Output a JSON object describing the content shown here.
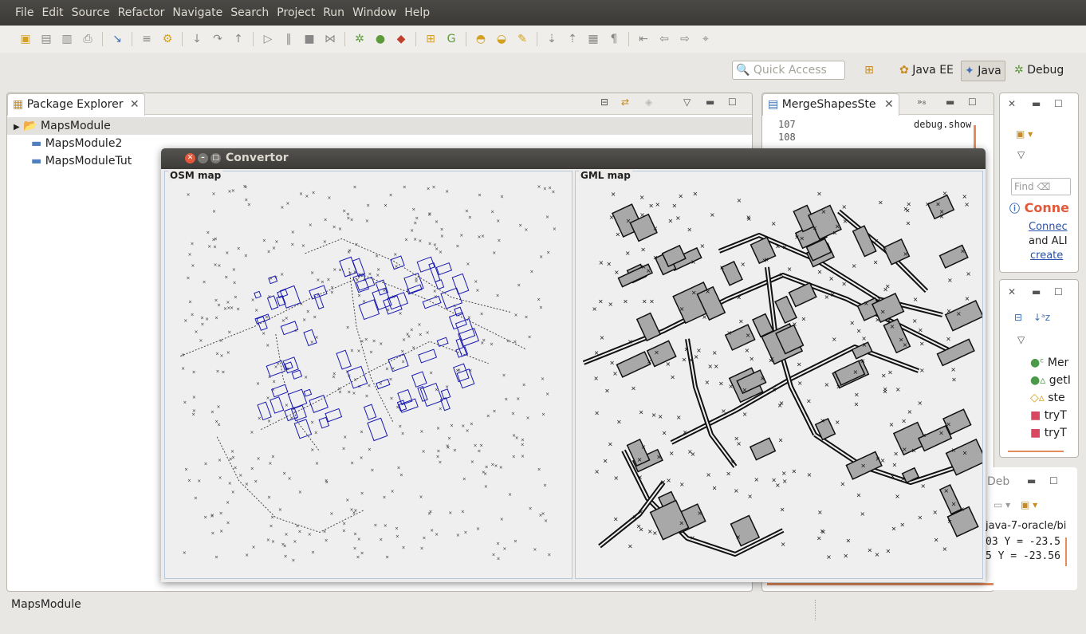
{
  "menu": [
    "File",
    "Edit",
    "Source",
    "Refactor",
    "Navigate",
    "Search",
    "Project",
    "Run",
    "Window",
    "Help"
  ],
  "quick_access": {
    "placeholder": "Quick Access"
  },
  "perspectives": {
    "java_ee": "Java EE",
    "java": "Java",
    "debug": "Debug"
  },
  "package_explorer": {
    "title": "Package Explorer",
    "items": [
      "MapsModule",
      "MapsModule2",
      "MapsModuleTut"
    ]
  },
  "editor": {
    "tab": "MergeShapesSte",
    "overflow": "»₈",
    "lines": [
      {
        "num": "107",
        "code": "debug.show"
      },
      {
        "num": "108",
        "code": ""
      }
    ]
  },
  "right_view1": {
    "find": "Find",
    "heading": "Conne",
    "link1": "Connec",
    "text": "and ALI",
    "link2": "create"
  },
  "outline": {
    "items": [
      "Mer",
      "getI",
      "ste",
      "tryT",
      "tryT"
    ]
  },
  "console": {
    "title": "Deb",
    "path": "java-7-oracle/bi",
    "line1": "03 Y = -23.5",
    "line2": "5 Y = -23.56"
  },
  "status": {
    "text": "MapsModule"
  },
  "convertor": {
    "title": "Convertor",
    "osm_label": "OSM map",
    "gml_label": "GML map"
  },
  "colors": {
    "osm_buildings": "#1a1ab0",
    "gml_buildings": "#a8a8a8",
    "accent": "#e2583a"
  }
}
